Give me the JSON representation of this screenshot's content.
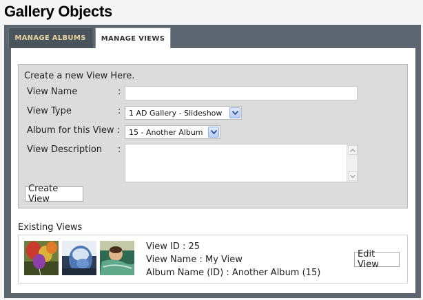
{
  "page": {
    "title": "Gallery Objects"
  },
  "tabs": [
    {
      "label": "MANAGE ALBUMS",
      "active": false
    },
    {
      "label": "MANAGE VIEWS",
      "active": true
    }
  ],
  "create_form": {
    "heading": "Create a new View Here.",
    "fields": {
      "view_name": {
        "label": "View Name",
        "colon": ":",
        "value": ""
      },
      "view_type": {
        "label": "View Type",
        "colon": ":",
        "value": "1 AD Gallery - Slideshow"
      },
      "album": {
        "label": "Album for this View :",
        "value": "15 - Another Album"
      },
      "description": {
        "label": "View Description",
        "colon": ":",
        "value": ""
      }
    },
    "submit_label": "Create View"
  },
  "existing": {
    "heading": "Existing Views",
    "views": [
      {
        "view_id_line": "View ID : 25",
        "view_name_line": "View Name : My View",
        "album_line": "Album Name (ID) : Another Album (15)",
        "edit_label": "Edit View",
        "thumbnails": [
          "balloons-photo",
          "airplane-window-photo",
          "swimmer-photo"
        ]
      }
    ]
  },
  "colors": {
    "frame": "#5b6670",
    "inactive_tab_text": "#e8d39a",
    "form_panel": "#dcdcdc",
    "select_arrow": "#4a6fb5"
  }
}
